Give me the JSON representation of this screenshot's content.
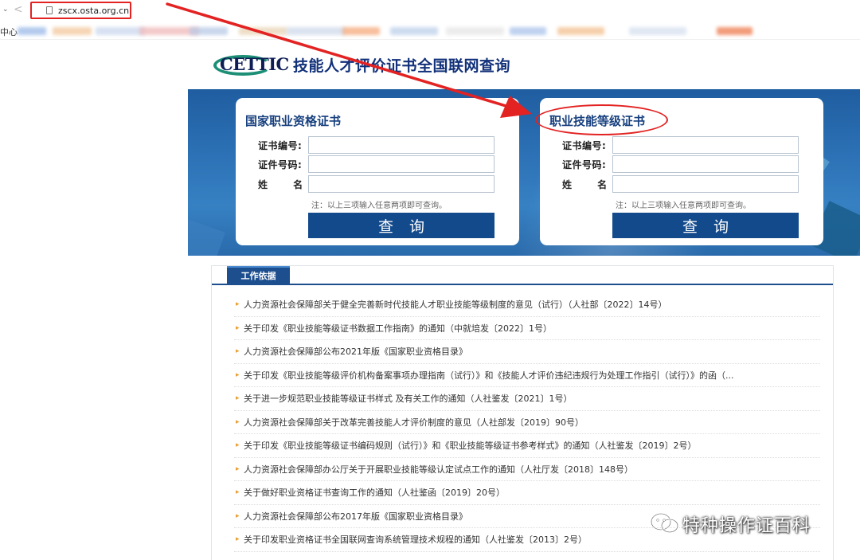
{
  "browser": {
    "url": "zscx.osta.org.cn",
    "bookmark_first": "中心",
    "bookmark_blur_colors": [
      "#9bb9e8",
      "#f2c79c",
      "#c9d7ee",
      "#f0b9b9",
      "#b7c9e6",
      "#e8d3b4",
      "#cfd9ea",
      "#f5a97a",
      "#bcd0ea",
      "#e6e6e6",
      "#a9c3ea",
      "#f3c08f",
      "#d6e0ef",
      "#ee7b4e"
    ]
  },
  "header": {
    "logo_text": "CETTIC",
    "title": "技能人才评价证书全国联网查询"
  },
  "panels": {
    "left": {
      "title": "国家职业资格证书",
      "label_cert_no": "证书编号:",
      "label_id_no": "证件号码:",
      "label_name": "姓 名:",
      "note": "注：以上三项输入任意两项即可查询。",
      "button": "查询"
    },
    "right": {
      "title": "职业技能等级证书",
      "label_cert_no": "证书编号:",
      "label_id_no": "证件号码:",
      "label_name": "姓 名:",
      "note": "注：以上三项输入任意两项即可查询。",
      "button": "查询"
    }
  },
  "content": {
    "tab": "工作依据",
    "items": [
      "人力资源社会保障部关于健全完善新时代技能人才职业技能等级制度的意见（试行）（人社部〔2022〕14号）",
      "关于印发《职业技能等级证书数据工作指南》的通知（中就培发〔2022〕1号）",
      "人力资源社会保障部公布2021年版《国家职业资格目录》",
      "关于印发《职业技能等级评价机构备案事项办理指南（试行）》和《技能人才评价违纪违规行为处理工作指引（试行）》的函（...",
      "关于进一步规范职业技能等级证书样式 及有关工作的通知（人社鉴发〔2021〕1号）",
      "人力资源社会保障部关于改革完善技能人才评价制度的意见（人社部发〔2019〕90号）",
      "关于印发《职业技能等级证书编码规则（试行）》和《职业技能等级证书参考样式》的通知（人社鉴发〔2019〕2号）",
      "人力资源社会保障部办公厅关于开展职业技能等级认定试点工作的通知（人社厅发〔2018〕148号）",
      "关于做好职业资格证书查询工作的通知（人社鉴函〔2019〕20号）",
      "人力资源社会保障部公布2017年版《国家职业资格目录》",
      "关于印发职业资格证书全国联网查询系统管理技术规程的通知（人社鉴发〔2013〕2号）"
    ]
  },
  "watermark": {
    "text": "特种操作证百科"
  },
  "colors": {
    "annotation_red": "#e32222",
    "brand_blue": "#134a8c",
    "title_blue": "#12317a",
    "bullet_orange": "#e8a033"
  }
}
